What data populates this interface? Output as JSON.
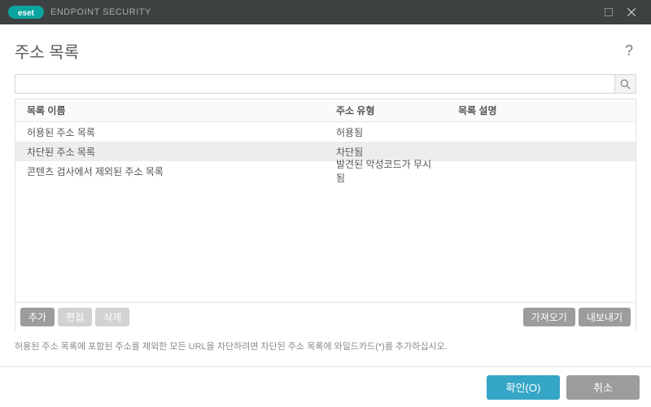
{
  "titlebar": {
    "brand": "ENDPOINT SECURITY"
  },
  "heading": "주소 목록",
  "search": {
    "value": ""
  },
  "table": {
    "headers": {
      "name": "목록 이름",
      "type": "주소 유형",
      "desc": "목록 설명"
    },
    "rows": [
      {
        "name": "허용된 주소 목록",
        "type": "허용됨",
        "desc": "",
        "selected": false
      },
      {
        "name": "차단된 주소 목록",
        "type": "차단됨",
        "desc": "",
        "selected": true
      },
      {
        "name": "콘텐츠 검사에서 제외된 주소 목록",
        "type": "발견된 악성코드가 무시됨",
        "desc": "",
        "selected": false
      }
    ]
  },
  "actions": {
    "add": "추가",
    "edit": "편집",
    "delete": "삭제",
    "import": "가져오기",
    "export": "내보내기"
  },
  "hint": "허용된 주소 목록에 포함된 주소를 제외한 모든 URL을 차단하려면 차단된 주소 목록에 와일드카드(*)를 추가하십시오.",
  "footer": {
    "ok": "확인(O)",
    "cancel": "취소"
  }
}
